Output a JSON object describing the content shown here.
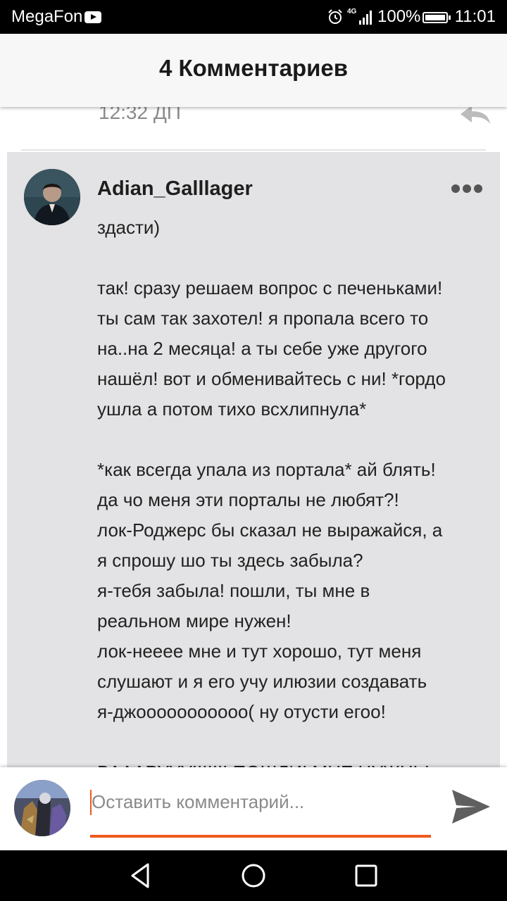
{
  "status_bar": {
    "carrier": "MegaFon",
    "network_label": "4G",
    "battery_percent": "100%",
    "time": "11:01",
    "icons": [
      "youtube-icon",
      "alarm-icon",
      "signal-icon",
      "battery-icon"
    ],
    "battery_level": 1.0
  },
  "header": {
    "title": "4 Комментариев"
  },
  "previous_comment": {
    "time": "12:32 ДП",
    "icon": "reply-icon"
  },
  "comment": {
    "username": "Adian_Galllager",
    "lines": [
      "здасти)",
      "",
      "так! сразу решаем вопрос с печеньками!",
      "ты сам так захотел! я пропала всего то",
      "на..на 2 месяца! а ты себе уже другого",
      "нашёл! вот и обменивайтесь с ни! *гордо",
      "ушла а потом тихо всхлипнула*",
      "",
      "*как всегда упала из портала* ай блять!",
      "да чо меня эти порталы не любят?!",
      "лок-Роджерс бы сказал не выражайся, а",
      "я спрошу шо ты здесь забыла?",
      "я-тебя забыла! пошли, ты мне в",
      "реальном мире нужен!",
      "лок-нееее мне и тут хорошо, тут меня",
      "слушают и я его учу илюзии создавать",
      "я-джооооооооооо( ну отусти егоо!",
      "",
      "ВАААРУУУ!!!!!!! ПОШЛИ! МНЕ НУЖНЫ"
    ],
    "menu_icon": "more-dots-icon"
  },
  "comment_input": {
    "placeholder": "Оставить комментарий...",
    "value": ""
  },
  "colors": {
    "accent": "#ee5a1f",
    "comment_bg": "#e3e2e4",
    "header_bg": "#f7f7f7"
  },
  "nav_bar": {
    "icons": [
      "back-icon",
      "home-icon",
      "recents-icon"
    ]
  }
}
